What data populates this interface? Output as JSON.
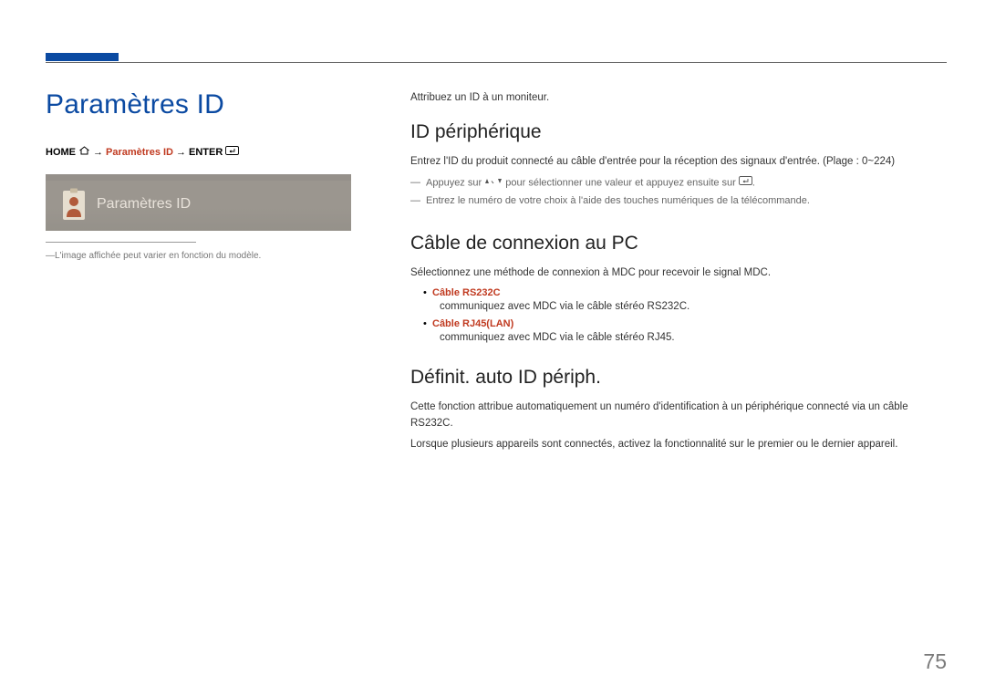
{
  "page": {
    "title": "Paramètres ID",
    "number": "75"
  },
  "nav": {
    "home": "HOME",
    "arrow": "→",
    "mid": "Paramètres ID",
    "enter": "ENTER"
  },
  "preview": {
    "label": "Paramètres ID"
  },
  "sidebar_note": "L'image affichée peut varier en fonction du modèle.",
  "intro": "Attribuez un ID à un moniteur.",
  "sections": {
    "device_id": {
      "heading": "ID périphérique",
      "desc": "Entrez l'ID du produit connecté au câble d'entrée pour la réception des signaux d'entrée. (Plage : 0~224)",
      "hint1a": "Appuyez sur",
      "hint1b": "pour sélectionner une valeur et appuyez ensuite sur",
      "hint1c": ".",
      "hint2": "Entrez le numéro de votre choix à l'aide des touches numériques de la télécommande."
    },
    "pc_cable": {
      "heading": "Câble de connexion au PC",
      "desc": "Sélectionnez une méthode de connexion à MDC pour recevoir le signal MDC.",
      "items": [
        {
          "label": "Câble RS232C",
          "desc": "communiquez avec MDC via le câble stéréo RS232C."
        },
        {
          "label": "Câble RJ45(LAN)",
          "desc": "communiquez avec MDC via le câble stéréo RJ45."
        }
      ]
    },
    "auto_id": {
      "heading": "Définit. auto ID périph.",
      "desc1": "Cette fonction attribue automatiquement un numéro d'identification à un périphérique connecté via un câble RS232C.",
      "desc2": "Lorsque plusieurs appareils sont connectés, activez la fonctionnalité sur le premier ou le dernier appareil."
    }
  }
}
